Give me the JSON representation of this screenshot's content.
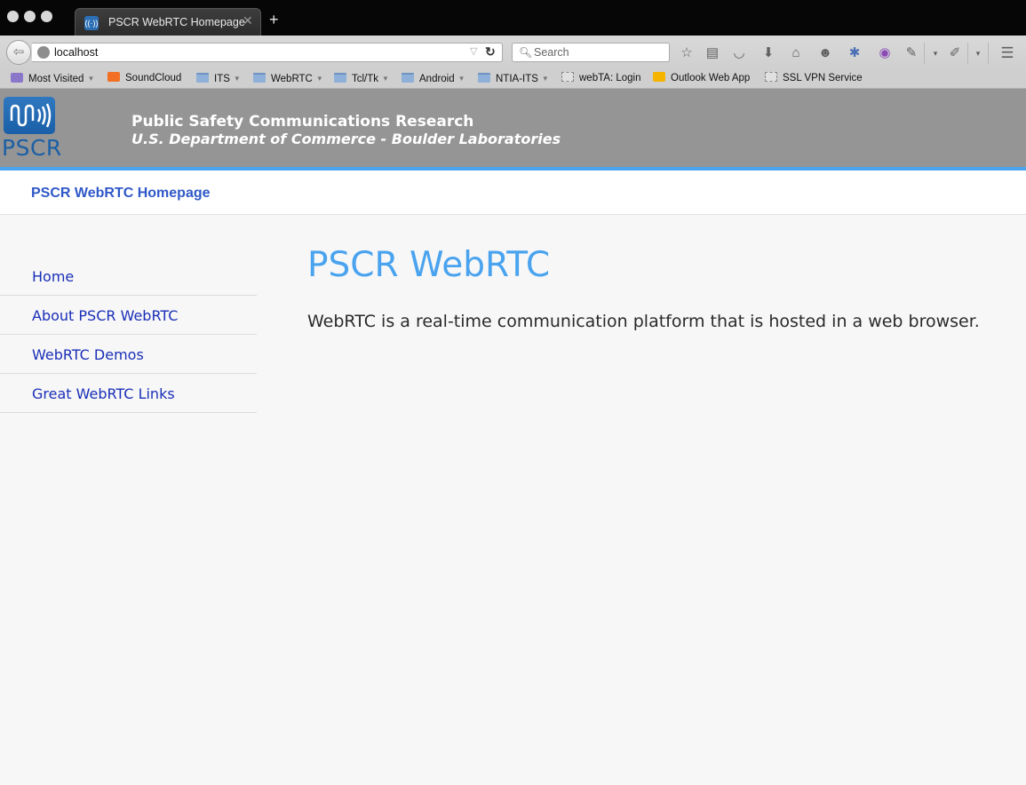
{
  "browser": {
    "tab_title": "PSCR WebRTC Homepage",
    "url": "localhost",
    "search_placeholder": "Search",
    "new_tab_label": "+"
  },
  "bookmarks": [
    {
      "label": "Most Visited",
      "icon": "most-visited-icon"
    },
    {
      "label": "SoundCloud",
      "icon": "soundcloud-icon"
    },
    {
      "label": "ITS",
      "icon": "folder-icon"
    },
    {
      "label": "WebRTC",
      "icon": "folder-icon"
    },
    {
      "label": "Tcl/Tk",
      "icon": "folder-icon"
    },
    {
      "label": "Android",
      "icon": "folder-icon"
    },
    {
      "label": "NTIA-ITS",
      "icon": "folder-icon"
    },
    {
      "label": "webTA: Login",
      "icon": "page-icon"
    },
    {
      "label": "Outlook Web App",
      "icon": "outlook-icon"
    },
    {
      "label": "SSL VPN Service",
      "icon": "page-icon"
    }
  ],
  "header": {
    "logo_text": "PSCR",
    "line1": "Public Safety Communications Research",
    "line2": "U.S. Department of Commerce - Boulder Laboratories"
  },
  "brand": {
    "label": "PSCR WebRTC Homepage"
  },
  "sidebar": {
    "items": [
      {
        "label": "Home"
      },
      {
        "label": "About PSCR WebRTC"
      },
      {
        "label": "WebRTC Demos"
      },
      {
        "label": "Great WebRTC Links"
      }
    ]
  },
  "main": {
    "heading": "PSCR WebRTC",
    "text": "WebRTC is a real-time communication platform that is hosted in a web browser."
  },
  "colors": {
    "header_bg": "#959595",
    "accent": "#4aa3ef",
    "link": "#1a2fb8",
    "brand_link": "#2f58c8"
  }
}
